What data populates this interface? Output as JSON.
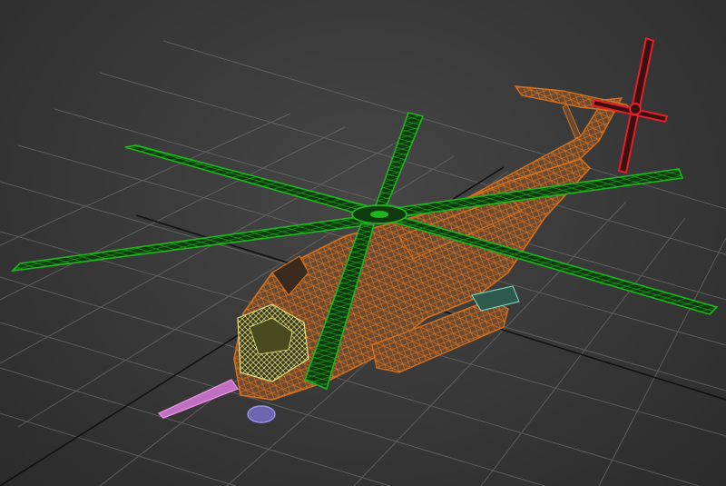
{
  "viewport": {
    "background_top": "#464646",
    "background_bottom": "#2b2b2b",
    "grid_color": "#6a6a6a",
    "grid_axis_color": "#111111"
  },
  "model": {
    "object_name": "helicopter-wireframe",
    "colors": {
      "fuselage_wire": "#d4701e",
      "fuselage_fill": "#6b4a32",
      "main_rotor_wire": "#1fb51f",
      "main_rotor_fill": "#0e3a0e",
      "tail_rotor_wire": "#e0202a",
      "refuel_probe": "#e68fe0",
      "nose_pod": "#9d8fe8",
      "cockpit_glass": "#e8e27a",
      "sponson_accent": "#7fe0c0"
    }
  }
}
